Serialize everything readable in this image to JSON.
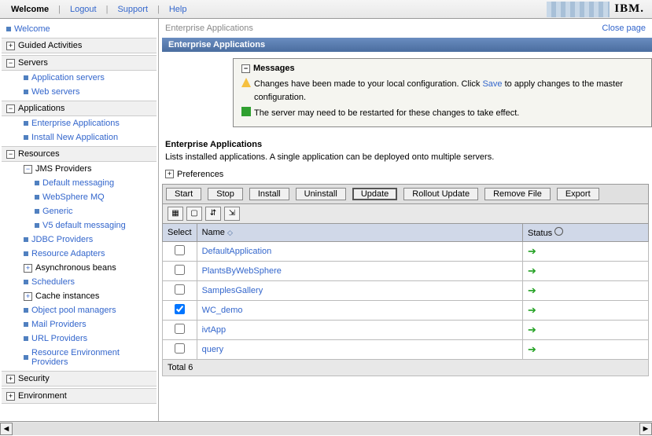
{
  "top": {
    "welcome": "Welcome",
    "logout": "Logout",
    "support": "Support",
    "help": "Help",
    "ibm": "IBM."
  },
  "nav": {
    "welcome": "Welcome",
    "guided": "Guided Activities",
    "servers": "Servers",
    "app_servers": "Application servers",
    "web_servers": "Web servers",
    "applications": "Applications",
    "ent_apps": "Enterprise Applications",
    "install_new": "Install New Application",
    "resources": "Resources",
    "jms": "JMS Providers",
    "def_msg": "Default messaging",
    "wmq": "WebSphere MQ",
    "generic": "Generic",
    "v5": "V5 default messaging",
    "jdbc": "JDBC Providers",
    "radapt": "Resource Adapters",
    "async": "Asynchronous beans",
    "sched": "Schedulers",
    "cache": "Cache instances",
    "objpool": "Object pool managers",
    "mail": "Mail Providers",
    "url": "URL Providers",
    "resenv": "Resource Environment Providers",
    "security": "Security",
    "environment": "Environment"
  },
  "page": {
    "breadcrumb": "Enterprise Applications",
    "close": "Close page",
    "title": "Enterprise Applications",
    "msg_header": "Messages",
    "msg1_pre": "Changes have been made to your local configuration. Click ",
    "msg1_link": "Save",
    "msg1_post": " to apply changes to the master configuration.",
    "msg2": "The server may need to be restarted for these changes to take effect.",
    "heading": "Enterprise Applications",
    "desc": "Lists installed applications. A single application can be deployed onto multiple servers.",
    "prefs": "Preferences"
  },
  "buttons": {
    "start": "Start",
    "stop": "Stop",
    "install": "Install",
    "uninstall": "Uninstall",
    "update": "Update",
    "rollout": "Rollout Update",
    "remove": "Remove File",
    "export": "Export"
  },
  "cols": {
    "select": "Select",
    "name": "Name",
    "status": "Status"
  },
  "rows": [
    {
      "name": "DefaultApplication",
      "checked": false
    },
    {
      "name": "PlantsByWebSphere",
      "checked": false
    },
    {
      "name": "SamplesGallery",
      "checked": false
    },
    {
      "name": "WC_demo",
      "checked": true
    },
    {
      "name": "ivtApp",
      "checked": false
    },
    {
      "name": "query",
      "checked": false
    }
  ],
  "footer": "Total 6"
}
